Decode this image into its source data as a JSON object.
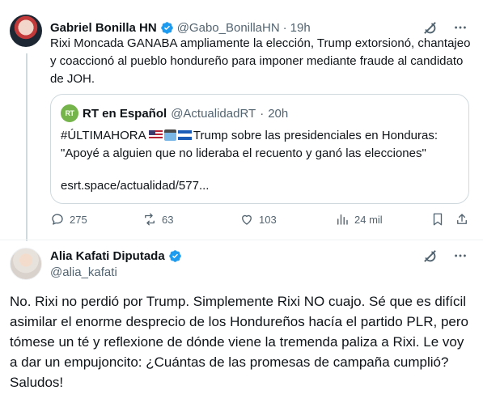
{
  "tweet1": {
    "author_name": "Gabriel Bonilla HN",
    "author_handle": "@Gabo_BonillaHN",
    "dot": "·",
    "time": "19h",
    "text": "Rixi Moncada GANABA ampliamente la elección, Trump extorsionó, chantajeo y coaccionó al pueblo hondureño para imponer mediante fraude al candidato de JOH.",
    "quote": {
      "logo_text": "RT",
      "author_name": "RT en Español",
      "author_handle": "@ActualidadRT",
      "dot": "·",
      "time": "20h",
      "hashtag": "#ÚLTIMAHORA",
      "text_after_flags": "Trump sobre las presidenciales en Honduras:",
      "text_line2": "\"Apoyé a alguien que no lideraba el recuento y ganó las elecciones\"",
      "link": "esrt.space/actualidad/577..."
    },
    "stats": {
      "replies": "275",
      "reposts": "63",
      "likes": "103",
      "views": "24 mil"
    }
  },
  "tweet2": {
    "author_name": "Alia Kafati Diputada",
    "author_handle": "@alia_kafati",
    "text": "No. Rixi no perdió por Trump. Simplemente Rixi NO cuajo. Sé que es difícil asimilar el enorme desprecio de los Hondureños hacía el partido PLR, pero tómese un té y reflexione de dónde viene la tremenda paliza a Rixi. Le voy a dar un empujoncito: ¿Cuántas de las promesas de campaña cumplió? Saludos!"
  },
  "colors": {
    "verified": "#1d9bf0",
    "secondary_text": "#536471",
    "border": "#cfd9de",
    "rt_green": "#74b44a"
  },
  "icons": [
    "verified-badge-icon",
    "grok-icon",
    "more-icon",
    "reply-icon",
    "repost-icon",
    "like-icon",
    "views-icon",
    "bookmark-icon",
    "share-icon"
  ]
}
